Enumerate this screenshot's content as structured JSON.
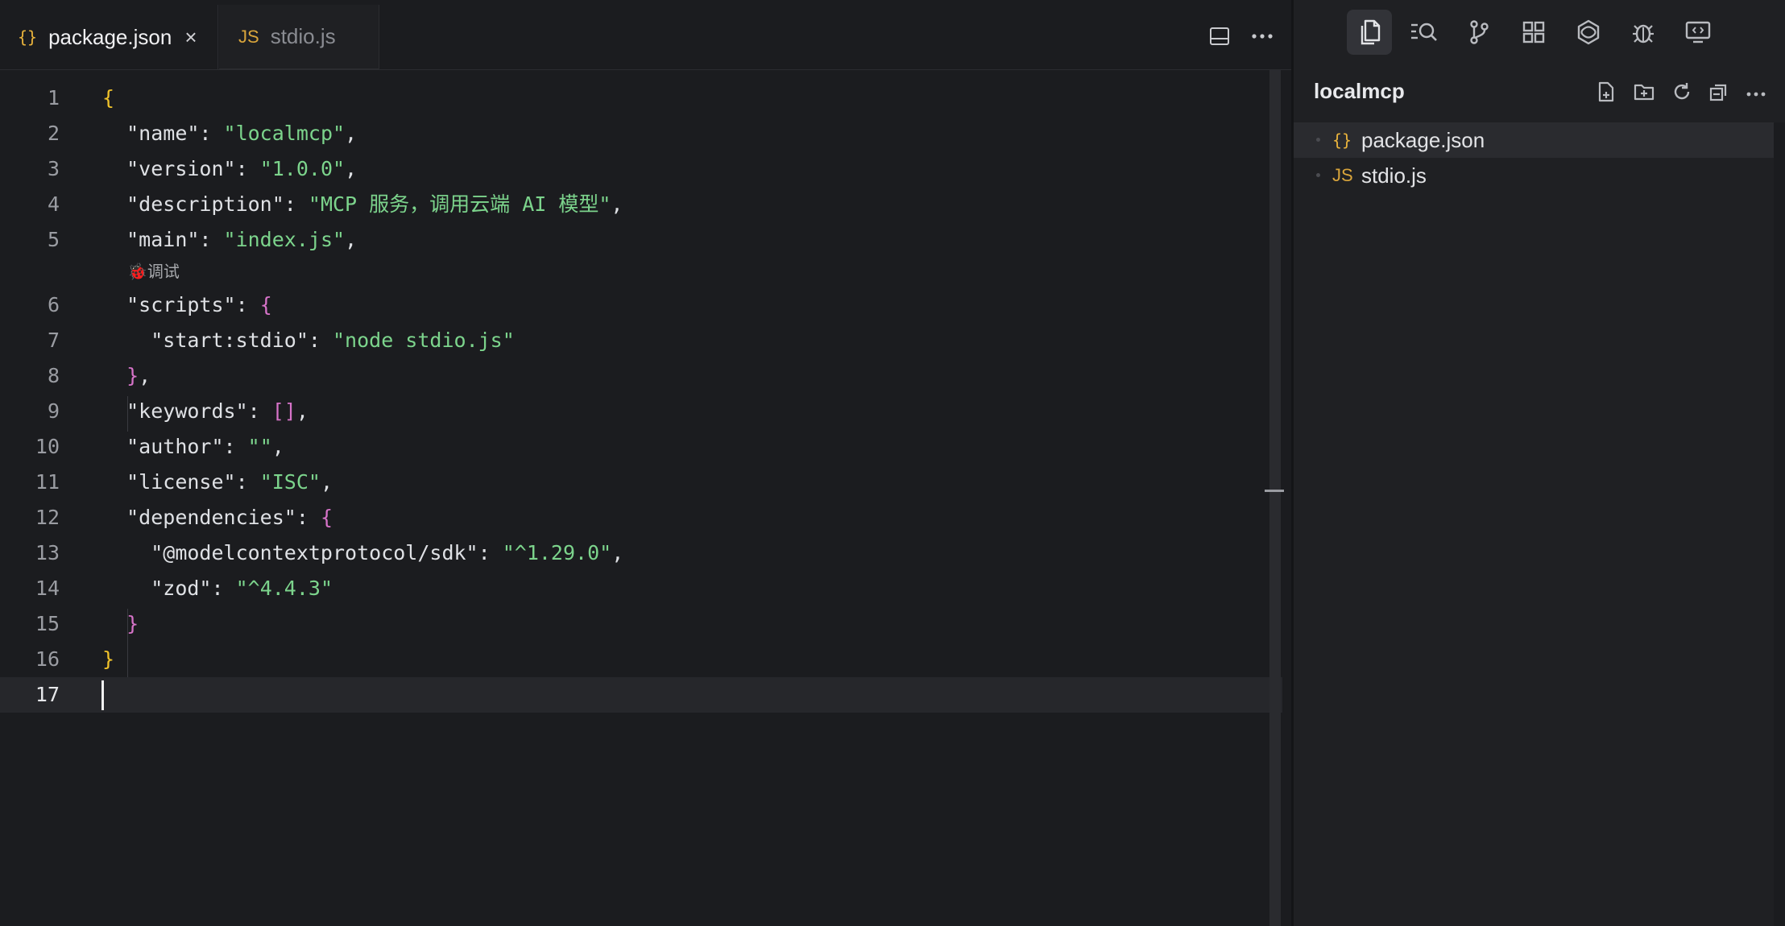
{
  "editor": {
    "tabs": [
      {
        "icon": "{}",
        "label": "package.json",
        "close": "×"
      },
      {
        "icon": "JS",
        "label": "stdio.js"
      }
    ],
    "codelens": "🐞调试",
    "lines": [
      {
        "n": "1"
      },
      {
        "n": "2"
      },
      {
        "n": "3"
      },
      {
        "n": "4"
      },
      {
        "n": "5"
      },
      {
        "n": "6"
      },
      {
        "n": "7"
      },
      {
        "n": "8"
      },
      {
        "n": "9"
      },
      {
        "n": "10"
      },
      {
        "n": "11"
      },
      {
        "n": "12"
      },
      {
        "n": "13"
      },
      {
        "n": "14"
      },
      {
        "n": "15"
      },
      {
        "n": "16"
      },
      {
        "n": "17"
      }
    ],
    "json": {
      "name_key": "\"name\"",
      "name_val": "\"localmcp\"",
      "version_key": "\"version\"",
      "version_val": "\"1.0.0\"",
      "description_key": "\"description\"",
      "description_val": "\"MCP 服务，调用云端 AI 模型\"",
      "main_key": "\"main\"",
      "main_val": "\"index.js\"",
      "scripts_key": "\"scripts\"",
      "start_key": "\"start:stdio\"",
      "start_val": "\"node stdio.js\"",
      "keywords_key": "\"keywords\"",
      "author_key": "\"author\"",
      "author_val": "\"\"",
      "license_key": "\"license\"",
      "license_val": "\"ISC\"",
      "deps_key": "\"dependencies\"",
      "sdk_key": "\"@modelcontextprotocol/sdk\"",
      "sdk_val": "\"^1.29.0\"",
      "zod_key": "\"zod\"",
      "zod_val": "\"^4.4.3\""
    }
  },
  "sidebar": {
    "title": "localmcp",
    "activity": [
      "files-icon",
      "search-icon",
      "source-control-icon",
      "extensions-icon",
      "ai-icon",
      "debug-icon",
      "remote-icon"
    ],
    "files": [
      {
        "icon": "{}",
        "label": "package.json",
        "selected": true
      },
      {
        "icon": "JS",
        "label": "stdio.js",
        "selected": false
      }
    ]
  },
  "colors": {
    "background": "#1b1c1f",
    "string": "#7cd48c",
    "bracket_level1": "#f0c22a",
    "bracket_level2": "#d673c8",
    "json_icon": "#e9b33c"
  }
}
